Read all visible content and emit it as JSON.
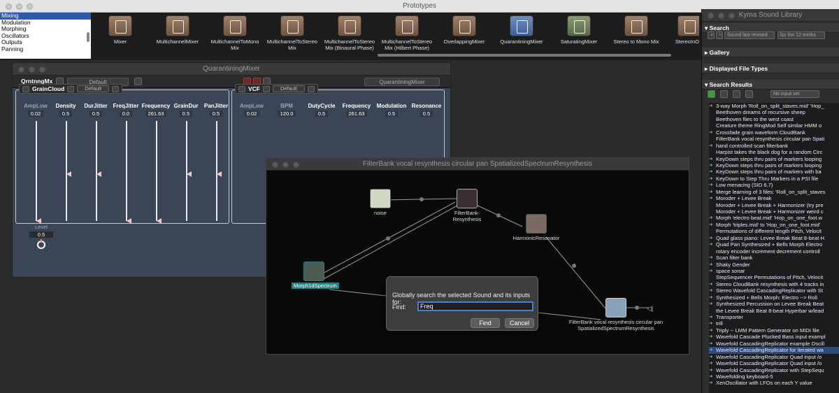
{
  "prototypes_window": {
    "title": "Prototypes",
    "categories": [
      "Mixing",
      "Modulation",
      "Morphing",
      "Oscillators",
      "Outputs",
      "Panning"
    ],
    "selected_category": "Mixing",
    "items": [
      {
        "label": "Mixer"
      },
      {
        "label": "MultichannelMixer"
      },
      {
        "label": "MultichannelToMono Mix"
      },
      {
        "label": "MultichannelToStereo Mix"
      },
      {
        "label": "MultichannelToStereo Mix (Binaural Phase)"
      },
      {
        "label": "MultichannelToStereo Mix (Hilbert Phase)"
      },
      {
        "label": "OverlappingMixer"
      },
      {
        "label": "QuarantiningMixer"
      },
      {
        "label": "SaturatingMixer"
      },
      {
        "label": "Stereo to Mono Mix"
      },
      {
        "label": "StereoInOut"
      }
    ]
  },
  "qm_window": {
    "title": "QuarantiningMixer",
    "short_name": "QrntnngMx",
    "left_popup": "Default",
    "right_popup": "QuarantiningMixer",
    "grain_panel": {
      "name": "GrainCloud",
      "popup": "Default",
      "params": [
        {
          "label": "AmpLow",
          "value": "0.02",
          "dim": true,
          "level": 0.0
        },
        {
          "label": "Density",
          "value": "0.5",
          "level": 0.48
        },
        {
          "label": "DurJitter",
          "value": "0.5",
          "level": 0.48
        },
        {
          "label": "FreqJitter",
          "value": "0.0",
          "level": 0.0
        },
        {
          "label": "Frequency",
          "value": "261.63",
          "level": 0.0
        },
        {
          "label": "GrainDur",
          "value": "0.5",
          "level": 0.48
        },
        {
          "label": "PanJitter",
          "value": "0.5",
          "level": 0.48
        }
      ]
    },
    "vcf_panel": {
      "name": "VCF",
      "popup": "Default",
      "params": [
        {
          "label": "AmpLow",
          "value": "0.02",
          "dim": true
        },
        {
          "label": "BPM",
          "value": "120.0",
          "dim": true
        },
        {
          "label": "DutyCycle",
          "value": "0.5"
        },
        {
          "label": "Frequency",
          "value": "261.63"
        },
        {
          "label": "Modulation",
          "value": "0.5"
        },
        {
          "label": "Resonance",
          "value": "0.5"
        }
      ]
    },
    "level": {
      "label": "Level",
      "value": "0.5"
    }
  },
  "fb_window": {
    "title": "FilterBank vocal resynthesis circular pan SpatializedSpectrumResynthesis",
    "nodes": {
      "noise": "noise",
      "filterbank": "FilterBank-Resynthesis",
      "harmonic": "HarmonicResonator",
      "morph": "Morph1dSpectrum",
      "output": "FilterBank vocal resynthesis circular pan SpatializedSpectrumResynthesis"
    }
  },
  "find_dialog": {
    "prompt": "Globally search the selected Sound and its inputs for:",
    "find_label": "Find:",
    "find_value": "Freq",
    "find_button": "Find",
    "cancel_button": "Cancel"
  },
  "library": {
    "title": "Kyma Sound Library",
    "search_header": "Search",
    "sort_popup": "Sound last revised",
    "range_popup": "lss thn 12 mnths",
    "gallery": "Gallery",
    "displayed_types": "Displayed File Types",
    "search_results": "Search Results",
    "input_popup": "No input set",
    "results": [
      {
        "text": "3-way Morph 'Roll_on_split_staves.mid' 'Hop_",
        "arrow": true
      },
      {
        "text": "Beethoven dreams of recursive sheep"
      },
      {
        "text": "Beethoven flies to the west coast"
      },
      {
        "text": "Creature theme RingMod Self similar HMM o"
      },
      {
        "text": "Crossfade grain waveform CloudBank",
        "arrow": true
      },
      {
        "text": "FilterBank vocal resynthesis circular pan Spati"
      },
      {
        "text": "hand controlled scan filterbank",
        "arrow": true
      },
      {
        "text": "Harpist takes the black dog for a random Circ"
      },
      {
        "text": "KeyDown steps thru pairs of markers looping",
        "arrow": true
      },
      {
        "text": "KeyDown steps thru pairs of markers looping",
        "arrow": true
      },
      {
        "text": "KeyDown steps thru pairs of markers with ba",
        "arrow": true
      },
      {
        "text": "KeyDown to Step Thru Markers in a PSI file",
        "arrow": true
      },
      {
        "text": "Low menacing (SID 6.7)",
        "arrow": true
      },
      {
        "text": "Merge learning of 3 files: 'Roll_on_split_staves",
        "arrow": true
      },
      {
        "text": "Moroder + Levee Break",
        "arrow": true
      },
      {
        "text": "Moroder + Levee Break + Harmonizer (try pre"
      },
      {
        "text": "Moroder + Levee Break + Harmonizer weird c"
      },
      {
        "text": "Morph 'electro beat.mid' 'Hop_on_one_foot.w",
        "arrow": true
      },
      {
        "text": "Morph 'triples.mid' to 'Hop_on_one_foot.mid'",
        "arrow": true
      },
      {
        "text": "Permutations of different length Pitch, Velocit"
      },
      {
        "text": "Quad glass piano: Levee Break Beat 8-beat H",
        "arrow": true
      },
      {
        "text": "Quad Pan Synthesized + Bells Morph Electro",
        "arrow": true
      },
      {
        "text": "rotary encoder increment decrement controll"
      },
      {
        "text": "Scan filter bank",
        "arrow": true
      },
      {
        "text": "Shaky Gender",
        "arrow": true
      },
      {
        "text": "space sonar",
        "arrow": true
      },
      {
        "text": "StepSequencer Permutations of Pitch, Velocit"
      },
      {
        "text": "Stereo CloudBank resynthesis with 4 tracks in",
        "arrow": true
      },
      {
        "text": "Stereo Wavefold CascadingReplicator with St",
        "arrow": true
      },
      {
        "text": "Synthesized + Bells Morph: Electro --> Roll",
        "arrow": true
      },
      {
        "text": "Synthesized Percussion on Levee Break Beat",
        "arrow": true
      },
      {
        "text": "the Levee Break Beat 8-beat Hyperbar w/lead"
      },
      {
        "text": "Transporter",
        "arrow": true
      },
      {
        "text": "trill",
        "arrow": true
      },
      {
        "text": "Triply -- LMM Pattern Generator on MIDI file",
        "arrow": true
      },
      {
        "text": "Wavefold Cascade Plucked Bass input exampl",
        "arrow": true
      },
      {
        "text": "Wavefold CascadingReplicator example Oscill",
        "arrow": true
      },
      {
        "text": "Wavefold CascadingReplicator for iterated wa",
        "arrow": true,
        "highlight": true
      },
      {
        "text": "Wavefold CascadingReplicator Quad input /o",
        "arrow": true
      },
      {
        "text": "Wavefold CascadingReplicator Quad input /o",
        "arrow": true
      },
      {
        "text": "Wavefold CascadingReplicator with StepSequ",
        "arrow": true
      },
      {
        "text": "Wavefolding keyboard-5",
        "arrow": true
      },
      {
        "text": "XenOscillator with LFOs on each Y value",
        "arrow": true
      }
    ]
  }
}
